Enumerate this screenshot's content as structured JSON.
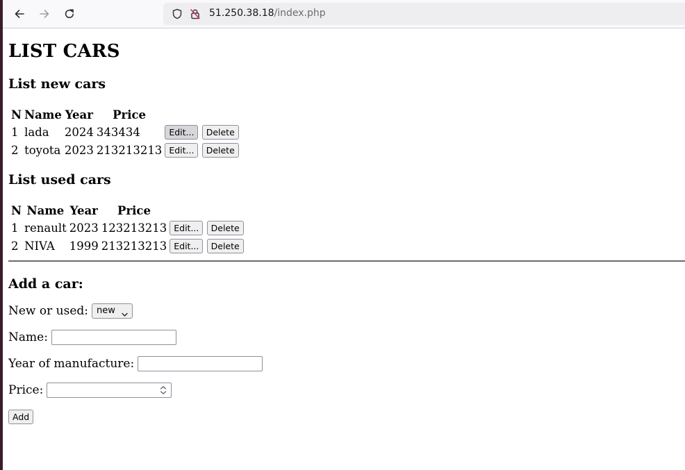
{
  "browser": {
    "url_host": "51.250.38.18",
    "url_path": "/index.php"
  },
  "page": {
    "title": "LIST CARS",
    "new_cars": {
      "heading": "List new cars",
      "headers": [
        "N",
        "Name",
        "Year",
        "Price"
      ],
      "rows": [
        {
          "n": "1",
          "name": "lada",
          "year": "2024",
          "price": "343434"
        },
        {
          "n": "2",
          "name": "toyota",
          "year": "2023",
          "price": "213213213"
        }
      ]
    },
    "used_cars": {
      "heading": "List used cars",
      "headers": [
        "N",
        "Name",
        "Year",
        "Price"
      ],
      "rows": [
        {
          "n": "1",
          "name": "renault",
          "year": "2023",
          "price": "123213213"
        },
        {
          "n": "2",
          "name": "NIVA",
          "year": "1999",
          "price": "213213213"
        }
      ]
    },
    "row_buttons": {
      "edit": "Edit...",
      "delete": "Delete"
    },
    "add_form": {
      "heading": "Add a car:",
      "type_label": "New or used:",
      "type_value": "new",
      "name_label": "Name:",
      "name_value": "",
      "year_label": "Year of manufacture:",
      "year_value": "",
      "price_label": "Price:",
      "price_value": "",
      "submit_label": "Add"
    }
  }
}
